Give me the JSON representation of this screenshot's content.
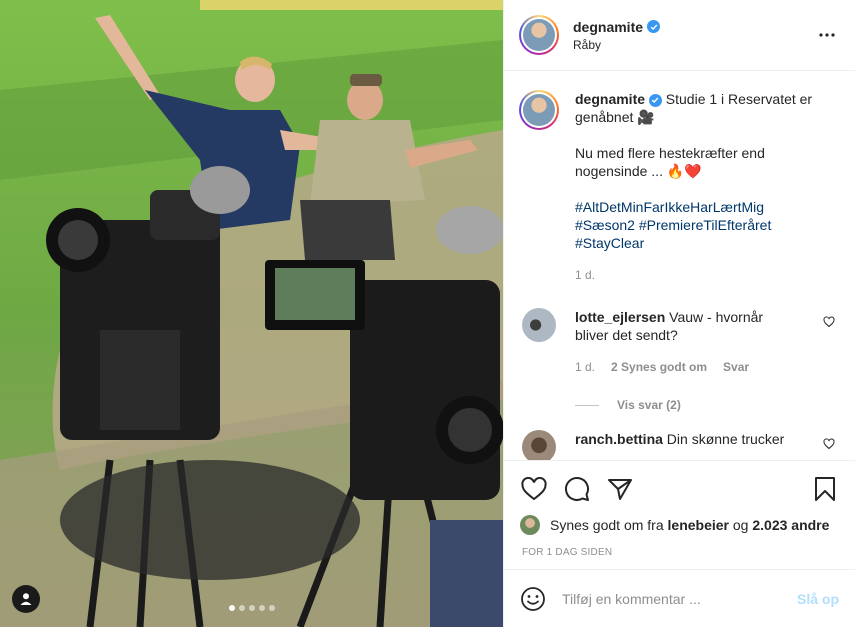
{
  "post": {
    "username": "degnamite",
    "location": "Råby",
    "caption_lead": "Studie 1 i Reservatet er genåbnet",
    "caption_lead_emoji": "🎥",
    "caption_line2": "Nu med flere hestekræfter end nogensinde ...",
    "caption_line2_emoji": "🔥❤️",
    "hashtags": [
      "#AltDetMinFarIkkeHarLærtMig",
      "#Sæson2 #PremiereTilEfteråret",
      "#StayClear"
    ],
    "time_ago": "1 d."
  },
  "comments": [
    {
      "username": "lotte_ejlersen",
      "text": "Vauw - hvornår bliver det sendt?",
      "time": "1 d.",
      "likes": "2 Synes godt om",
      "reply_label": "Svar",
      "view_replies": "Vis svar (2)"
    },
    {
      "username": "ranch.bettina",
      "text": "Din skønne trucker"
    }
  ],
  "likes": {
    "prefix": "Synes godt om fra",
    "user": "lenebeier",
    "joiner": "og",
    "others": "2.023 andre"
  },
  "posted_label": "FOR 1 DAG SIDEN",
  "add_comment": {
    "placeholder": "Tilføj en kommentar ...",
    "post_label": "Slå op"
  },
  "carousel": {
    "count": 5,
    "active_index": 0
  },
  "icons": {
    "more": "more-horizontal-icon",
    "like": "heart-icon",
    "comment": "comment-bubble-icon",
    "share": "paper-plane-icon",
    "save": "bookmark-icon",
    "emoji": "smiley-icon",
    "verified": "verified-badge-icon",
    "tag": "user-tag-icon"
  },
  "colors": {
    "link": "#00376b",
    "verified": "#3897f0",
    "muted": "#8e8e8e",
    "post_disabled": "#b2dffc"
  }
}
